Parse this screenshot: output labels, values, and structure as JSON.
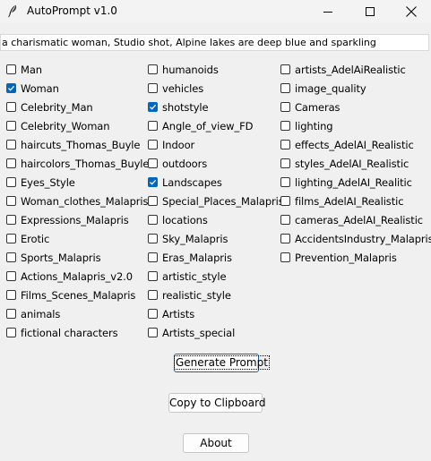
{
  "window": {
    "title": "AutoPrompt v1.0",
    "icon": "feather-icon"
  },
  "prompt_output": {
    "value": "a charismatic woman, Studio shot, Alpine lakes are deep blue and sparkling"
  },
  "columns": [
    {
      "items": [
        {
          "label": "Man",
          "checked": false
        },
        {
          "label": "Woman",
          "checked": true
        },
        {
          "label": "Celebrity_Man",
          "checked": false
        },
        {
          "label": "Celebrity_Woman",
          "checked": false
        },
        {
          "label": "haircuts_Thomas_Buyle",
          "checked": false
        },
        {
          "label": "haircolors_Thomas_Buyle",
          "checked": false
        },
        {
          "label": "Eyes_Style",
          "checked": false
        },
        {
          "label": "Woman_clothes_Malapris",
          "checked": false
        },
        {
          "label": "Expressions_Malapris",
          "checked": false
        },
        {
          "label": "Erotic",
          "checked": false
        },
        {
          "label": "Sports_Malapris",
          "checked": false
        },
        {
          "label": "Actions_Malapris_v2.0",
          "checked": false
        },
        {
          "label": "Films_Scenes_Malapris",
          "checked": false
        },
        {
          "label": "animals",
          "checked": false
        },
        {
          "label": "fictional characters",
          "checked": false
        }
      ]
    },
    {
      "items": [
        {
          "label": "humanoids",
          "checked": false
        },
        {
          "label": "vehicles",
          "checked": false
        },
        {
          "label": "shotstyle",
          "checked": true
        },
        {
          "label": "Angle_of_view_FD",
          "checked": false
        },
        {
          "label": "Indoor",
          "checked": false
        },
        {
          "label": "outdoors",
          "checked": false
        },
        {
          "label": "Landscapes",
          "checked": true
        },
        {
          "label": "Special_Places_Malapris",
          "checked": false
        },
        {
          "label": "locations",
          "checked": false
        },
        {
          "label": "Sky_Malapris",
          "checked": false
        },
        {
          "label": "Eras_Malapris",
          "checked": false
        },
        {
          "label": "artistic_style",
          "checked": false
        },
        {
          "label": "realistic_style",
          "checked": false
        },
        {
          "label": "Artists",
          "checked": false
        },
        {
          "label": "Artists_special",
          "checked": false
        }
      ]
    },
    {
      "items": [
        {
          "label": "artists_AdelAiRealistic",
          "checked": false
        },
        {
          "label": "image_quality",
          "checked": false
        },
        {
          "label": "Cameras",
          "checked": false
        },
        {
          "label": "lighting",
          "checked": false
        },
        {
          "label": "effects_AdelAI_Realistic",
          "checked": false
        },
        {
          "label": "styles_AdelAI_Realistic",
          "checked": false
        },
        {
          "label": "lighting_AdelAI_Realitic",
          "checked": false
        },
        {
          "label": "films_AdelAI_Realistic",
          "checked": false
        },
        {
          "label": "cameras_AdelAI_Realistic",
          "checked": false
        },
        {
          "label": "AccidentsIndustry_Malapris",
          "checked": false
        },
        {
          "label": "Prevention_Malapris",
          "checked": false
        }
      ]
    }
  ],
  "buttons": {
    "generate": "Generate Prompt",
    "copy": "Copy to Clipboard",
    "about": "About"
  },
  "colors": {
    "accent": "#0067c0",
    "window_bg": "#f0f0f0"
  }
}
